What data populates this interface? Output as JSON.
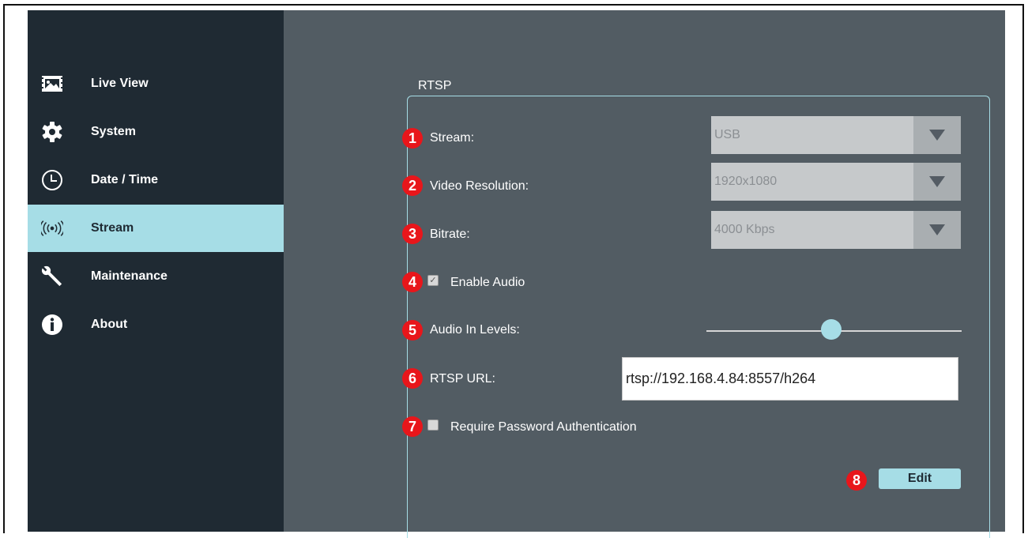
{
  "sidebar": {
    "items": [
      {
        "label": "Live View",
        "icon": "image-icon"
      },
      {
        "label": "System",
        "icon": "gear-icon"
      },
      {
        "label": "Date / Time",
        "icon": "clock-icon"
      },
      {
        "label": "Stream",
        "icon": "broadcast-icon"
      },
      {
        "label": "Maintenance",
        "icon": "wrench-icon"
      },
      {
        "label": "About",
        "icon": "info-icon"
      }
    ],
    "active_index": 3
  },
  "rtsp": {
    "section_title": "RTSP",
    "stream": {
      "badge": "1",
      "label": "Stream:",
      "value": "USB"
    },
    "resolution": {
      "badge": "2",
      "label": "Video Resolution:",
      "value": "1920x1080"
    },
    "bitrate": {
      "badge": "3",
      "label": "Bitrate:",
      "value": "4000 Kbps"
    },
    "audio": {
      "badge": "4",
      "label": "Enable Audio",
      "checked": true
    },
    "audio_levels": {
      "badge": "5",
      "label": "Audio In Levels:",
      "level": 0.49
    },
    "url": {
      "badge": "6",
      "label": "RTSP URL:",
      "value": "rtsp://192.168.4.84:8557/h264"
    },
    "password": {
      "badge": "7",
      "label": "Require Password Authentication",
      "checked": false
    },
    "edit": {
      "badge": "8",
      "label": "Edit"
    }
  },
  "colors": {
    "sidebar_bg": "#1f2a33",
    "main_bg": "#525c63",
    "accent": "#a6dde6",
    "badge": "#e8161b"
  }
}
